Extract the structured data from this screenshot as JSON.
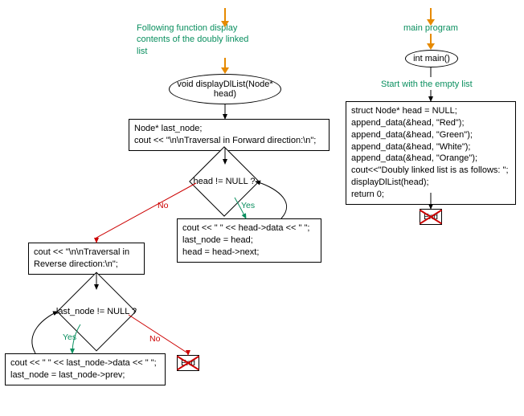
{
  "left": {
    "caption": "Following function display\ncontents of the doubly\nlinked list",
    "func_sig": "void displayDlList(Node* head)",
    "block1": "Node* last_node;\ncout << \"\\n\\nTraversal in Forward direction:\\n\";",
    "cond1": "head != NULL ?",
    "yes1": "Yes",
    "no1": "No",
    "loop1_body": "cout << \" \" << head->data << \" \";\nlast_node = head;\nhead = head->next;",
    "block2": "cout << \"\\n\\nTraversal in\nReverse direction:\\n\";",
    "cond2": "last_node != NULL ?",
    "yes2": "Yes",
    "no2": "No",
    "loop2_body": "cout << \" \" << last_node->data << \" \";\nlast_node = last_node->prev;",
    "end": "End"
  },
  "right": {
    "caption": "main program",
    "func_sig": "int main()",
    "subcaption": "Start with the empty list",
    "body": "struct Node* head = NULL;\nappend_data(&head, \"Red\");\nappend_data(&head, \"Green\");\nappend_data(&head, \"White\");\nappend_data(&head, \"Orange\");\ncout<<\"Doubly linked list is as follows: \";\ndisplayDlList(head);\nreturn 0;",
    "end": "End"
  }
}
